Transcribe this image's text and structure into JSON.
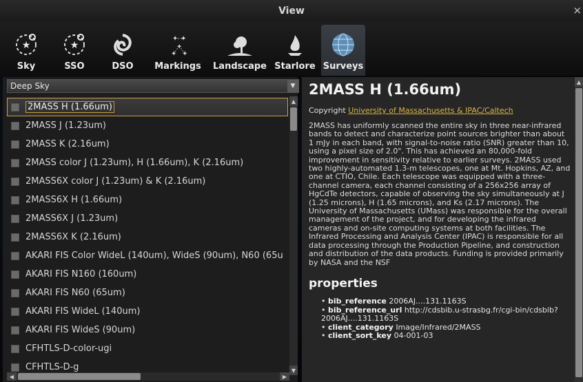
{
  "window": {
    "title": "View",
    "close_label": "×"
  },
  "tabs": [
    {
      "label": "Sky",
      "icon": "sky-icon"
    },
    {
      "label": "SSO",
      "icon": "sso-icon"
    },
    {
      "label": "DSO",
      "icon": "dso-icon"
    },
    {
      "label": "Markings",
      "icon": "markings-icon"
    },
    {
      "label": "Landscape",
      "icon": "landscape-icon"
    },
    {
      "label": "Starlore",
      "icon": "starlore-icon"
    },
    {
      "label": "Surveys",
      "icon": "surveys-icon",
      "active": true
    }
  ],
  "category": {
    "selected": "Deep Sky"
  },
  "surveys": [
    "2MASS H (1.66um)",
    "2MASS J (1.23um)",
    "2MASS K (2.16um)",
    "2MASS color J (1.23um), H (1.66um), K (2.16um)",
    "2MASS6X color J (1.23um) & K (2.16um)",
    "2MASS6X H (1.66um)",
    "2MASS6X J (1.23um)",
    "2MASS6X K (2.16um)",
    "AKARI FIS Color WideL (140um), WideS (90um), N60 (65u",
    "AKARI FIS N160 (160um)",
    "AKARI FIS N60 (65um)",
    "AKARI FIS WideL (140um)",
    "AKARI FIS WideS (90um)",
    "CFHTLS-D-color-ugi",
    "CFHTLS-D-g"
  ],
  "detail": {
    "title": "2MASS H (1.66um)",
    "copyright_label": "Copyright",
    "copyright_link": "University of Massachusetts & IPAC/Caltech",
    "description": "2MASS has uniformly scanned the entire sky in three near-infrared bands to detect and characterize point sources brighter than about 1 mJy in each band, with signal-to-noise ratio (SNR) greater than 10, using a pixel size of 2.0\". This has achieved an 80,000-fold improvement in sensitivity relative to earlier surveys. 2MASS used two highly-automated 1.3-m telescopes, one at Mt. Hopkins, AZ, and one at CTIO, Chile. Each telescope was equipped with a three-channel camera, each channel consisting of a 256x256 array of HgCdTe detectors, capable of observing the sky simultaneously at J (1.25 microns), H (1.65 microns), and Ks (2.17 microns). The University of Massachusetts (UMass) was responsible for the overall management of the project, and for developing the infrared cameras and on-site computing systems at both facilities. The Infrared Processing and Analysis Center (IPAC) is responsible for all data processing through the Production Pipeline, and construction and distribution of the data products. Funding is provided primarily by NASA and the NSF",
    "properties_heading": "properties",
    "properties": [
      {
        "key": "bib_reference",
        "value": "2006AJ....131.1163S"
      },
      {
        "key": "bib_reference_url",
        "value": "http://cdsbib.u-strasbg.fr/cgi-bin/cdsbib?2006AJ....131.1163S"
      },
      {
        "key": "client_category",
        "value": "Image/Infrared/2MASS"
      },
      {
        "key": "client_sort_key",
        "value": "04-001-03"
      }
    ]
  },
  "colors": {
    "accent": "#d9b44a",
    "panel": "#262626",
    "list_bg": "#1d1d1d"
  }
}
